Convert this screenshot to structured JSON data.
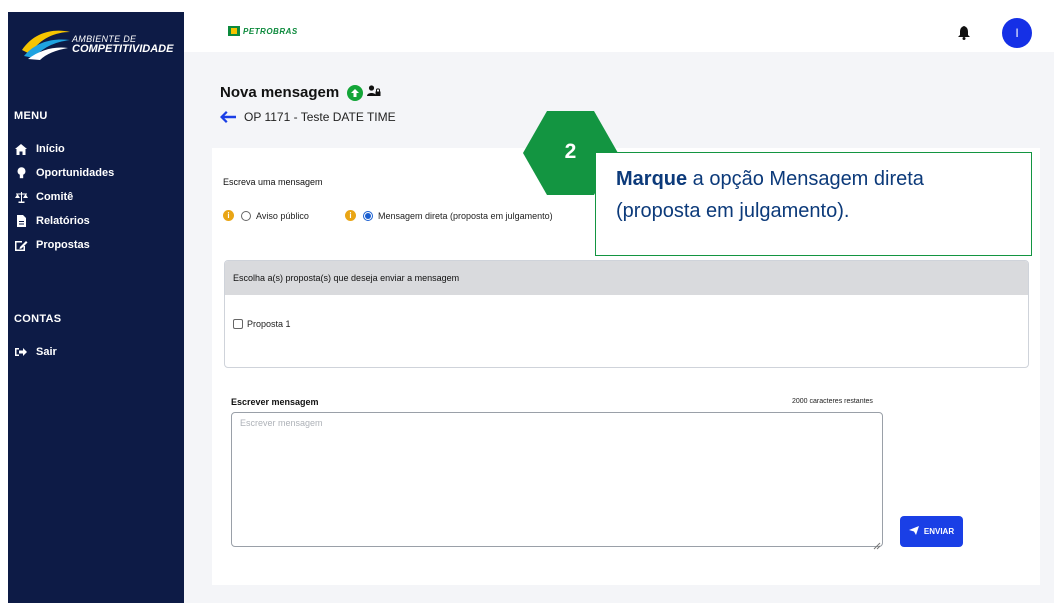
{
  "sidebar": {
    "logo": {
      "line1": "AMBIENTE DE",
      "line2": "COMPETITIVIDADE"
    },
    "menu_label": "MENU",
    "items": [
      {
        "label": "Início",
        "icon": "home-icon"
      },
      {
        "label": "Oportunidades",
        "icon": "lightbulb-icon"
      },
      {
        "label": "Comitê",
        "icon": "scale-icon"
      },
      {
        "label": "Relatórios",
        "icon": "file-icon"
      },
      {
        "label": "Propostas",
        "icon": "edit-icon"
      }
    ],
    "accounts_label": "CONTAS",
    "logout_label": "Sair"
  },
  "topbar": {
    "brand": "PETROBRAS",
    "avatar_initial": "I",
    "colors": {
      "brand_green": "#0d8a3d",
      "brand_yellow": "#f5c400",
      "avatar_blue": "#1530e6"
    }
  },
  "header": {
    "title": "Nova mensagem",
    "subtitle": "OP 1171 - Teste DATE TIME"
  },
  "form": {
    "write_label": "Escreva uma mensagem",
    "options": [
      {
        "label": "Aviso público",
        "selected": false
      },
      {
        "label": "Mensagem direta (proposta em julgamento)",
        "selected": true
      }
    ],
    "choose_header": "Escolha a(s) proposta(s) que deseja enviar a mensagem",
    "proposals": [
      {
        "label": "Proposta 1",
        "checked": false
      }
    ],
    "message_label": "Escrever mensagem",
    "counter": "2000 caracteres restantes",
    "message_placeholder": "Escrever mensagem",
    "message_value": "",
    "send_label": "ENVIAR"
  },
  "callout": {
    "step": "2",
    "bold": "Marque",
    "line1_rest": " a opção Mensagem direta",
    "line2": "(proposta em julgamento).",
    "colors": {
      "green": "#139541",
      "text": "#0c3a7a"
    }
  }
}
